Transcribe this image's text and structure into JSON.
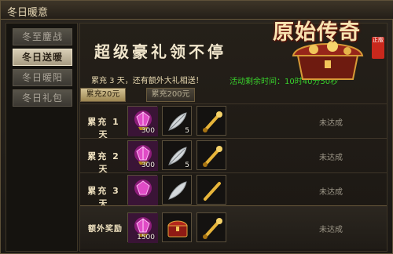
{
  "window": {
    "title": "冬日暖意"
  },
  "sidebar": {
    "items": [
      {
        "label": "冬至鏖战",
        "active": false
      },
      {
        "label": "冬日送暖",
        "active": true
      },
      {
        "label": "冬日暖阳",
        "active": false
      },
      {
        "label": "冬日礼包",
        "active": false
      }
    ]
  },
  "main": {
    "headline": "超级豪礼领不停",
    "subtitle": "累充 3 天，还有额外大礼相送！",
    "time_remaining": "活动剩余时间：10时40分50秒",
    "tabs": [
      {
        "label": "累充20元",
        "active": true
      },
      {
        "label": "累充200元",
        "active": false
      }
    ],
    "rows": [
      {
        "label": "累充 1 天",
        "status": "未达成",
        "rewards": [
          {
            "icon": "purple-gem-icon",
            "qty": "300"
          },
          {
            "icon": "feather-icon",
            "qty": "5"
          },
          {
            "icon": "golden-scroll-icon",
            "qty": ""
          }
        ]
      },
      {
        "label": "累充 2 天",
        "status": "未达成",
        "rewards": [
          {
            "icon": "purple-gem-icon",
            "qty": "300"
          },
          {
            "icon": "feather-icon",
            "qty": "5"
          },
          {
            "icon": "golden-scroll-icon",
            "qty": ""
          }
        ]
      },
      {
        "label": "累充 3 天",
        "status": "未达成",
        "rewards": [
          {
            "icon": "purple-gem-icon",
            "qty": ""
          },
          {
            "icon": "feather-icon",
            "qty": ""
          },
          {
            "icon": "golden-scroll-icon",
            "qty": ""
          }
        ]
      }
    ],
    "bonus": {
      "label": "额外奖励",
      "status": "未达成",
      "rewards": [
        {
          "icon": "purple-gem-icon",
          "qty": "1500"
        },
        {
          "icon": "red-chest-icon",
          "qty": ""
        },
        {
          "icon": "golden-scroll-icon",
          "qty": ""
        }
      ]
    }
  },
  "logo": {
    "text": "原始传奇",
    "seal": "正版"
  },
  "colors": {
    "accent_green": "#39d12c",
    "gold_text": "#f1e6cc",
    "panel_dark": "#1b1713",
    "border_gold": "#6a5a3c"
  }
}
